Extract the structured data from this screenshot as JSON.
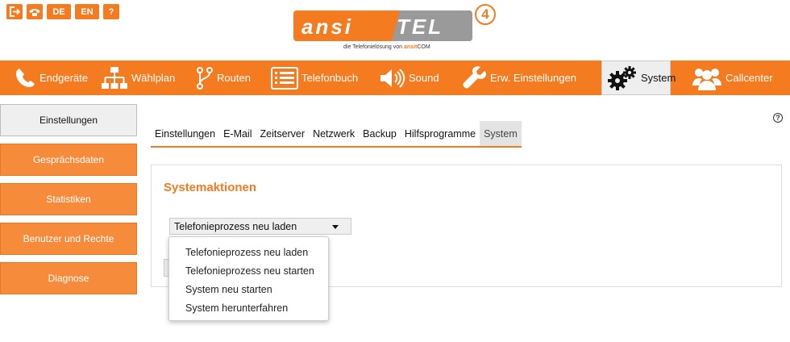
{
  "util_bar": {
    "icons": [
      {
        "name": "logout-icon"
      },
      {
        "name": "phone-icon"
      },
      {
        "name": "lang-de",
        "label": "DE"
      },
      {
        "name": "lang-en",
        "label": "EN"
      },
      {
        "name": "help-icon",
        "label": "?"
      }
    ]
  },
  "logo": {
    "left_text": "ansi",
    "right_text": "TEL",
    "badge": "4",
    "subtitle_prefix": "die Telefonielösung von",
    "subtitle_brand": "ansit",
    "subtitle_suffix": "COM"
  },
  "main_nav": {
    "items": [
      {
        "label": "Endgeräte",
        "icon": "phone-icon"
      },
      {
        "label": "Wählplan",
        "icon": "sitemap-icon"
      },
      {
        "label": "Routen",
        "icon": "route-icon"
      },
      {
        "label": "Telefonbuch",
        "icon": "phonebook-icon"
      },
      {
        "label": "Sound",
        "icon": "speaker-icon"
      },
      {
        "label": "Erw. Einstellungen",
        "icon": "wrench-icon"
      },
      {
        "label": "System",
        "icon": "gears-icon",
        "active": true
      },
      {
        "label": "Callcenter",
        "icon": "users-icon"
      }
    ]
  },
  "sidebar": {
    "items": [
      {
        "label": "Einstellungen",
        "active": true
      },
      {
        "label": "Gesprächsdaten"
      },
      {
        "label": "Statistiken"
      },
      {
        "label": "Benutzer und Rechte"
      },
      {
        "label": "Diagnose"
      }
    ]
  },
  "help": {
    "label": "?"
  },
  "sub_tabs": {
    "items": [
      {
        "label": "Einstellungen"
      },
      {
        "label": "E-Mail"
      },
      {
        "label": "Zeitserver"
      },
      {
        "label": "Netzwerk"
      },
      {
        "label": "Backup"
      },
      {
        "label": "Hilfsprogramme"
      },
      {
        "label": "System",
        "active": true
      }
    ]
  },
  "content": {
    "title": "Systemaktionen",
    "select_value": "Telefonieprozess neu laden",
    "options": [
      "Telefonieprozess neu laden",
      "Telefonieprozess neu starten",
      "System neu starten",
      "System herunterfahren"
    ]
  },
  "colors": {
    "accent": "#f47b20",
    "sidebar_button": "#f68b3c",
    "logo_gray": "#9a9a9a"
  }
}
